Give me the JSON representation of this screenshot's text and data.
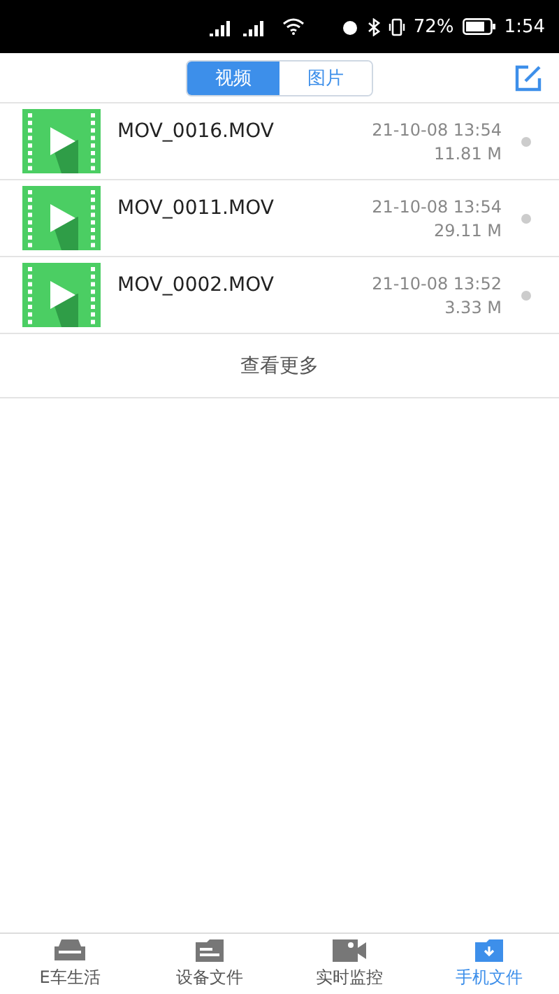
{
  "status_bar": {
    "battery": "72%",
    "time": "1:54"
  },
  "segments": [
    {
      "label": "视频",
      "selected": true
    },
    {
      "label": "图片",
      "selected": false
    }
  ],
  "files": [
    {
      "name": "MOV_0016.MOV",
      "date": "21-10-08 13:54",
      "size": "11.81 M"
    },
    {
      "name": "MOV_0011.MOV",
      "date": "21-10-08 13:54",
      "size": "29.11 M"
    },
    {
      "name": "MOV_0002.MOV",
      "date": "21-10-08 13:52",
      "size": "3.33 M"
    }
  ],
  "more": "查看更多",
  "nav": [
    {
      "label": "E车生活",
      "kind": "car",
      "selected": false
    },
    {
      "label": "设备文件",
      "kind": "folder",
      "selected": false
    },
    {
      "label": "实时监控",
      "kind": "camera",
      "selected": false
    },
    {
      "label": "手机文件",
      "kind": "phone",
      "selected": true
    }
  ]
}
